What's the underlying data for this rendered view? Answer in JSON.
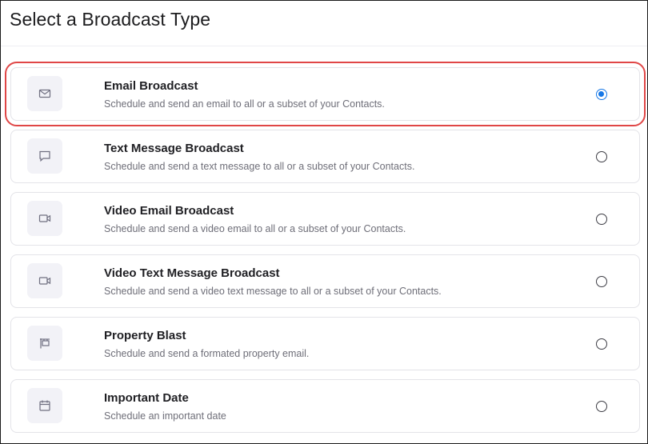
{
  "page": {
    "title": "Select a Broadcast Type"
  },
  "options": [
    {
      "title": "Email Broadcast",
      "description": "Schedule and send an email to all or a subset of your Contacts.",
      "icon": "envelope-icon",
      "selected": true
    },
    {
      "title": "Text Message Broadcast",
      "description": "Schedule and send a text message to all or a subset of your Contacts.",
      "icon": "chat-bubble-icon",
      "selected": false
    },
    {
      "title": "Video Email Broadcast",
      "description": "Schedule and send a video email to all or a subset of your Contacts.",
      "icon": "video-camera-icon",
      "selected": false
    },
    {
      "title": "Video Text Message Broadcast",
      "description": "Schedule and send a video text message to all or a subset of your Contacts.",
      "icon": "video-camera-icon",
      "selected": false
    },
    {
      "title": "Property Blast",
      "description": "Schedule and send a formated property email.",
      "icon": "property-sign-icon",
      "selected": false
    },
    {
      "title": "Important Date",
      "description": "Schedule an important date",
      "icon": "calendar-icon",
      "selected": false
    }
  ],
  "colors": {
    "selection_highlight": "#e04646",
    "radio_checked": "#1677e6",
    "icon_tile_bg": "#f2f2f7"
  }
}
